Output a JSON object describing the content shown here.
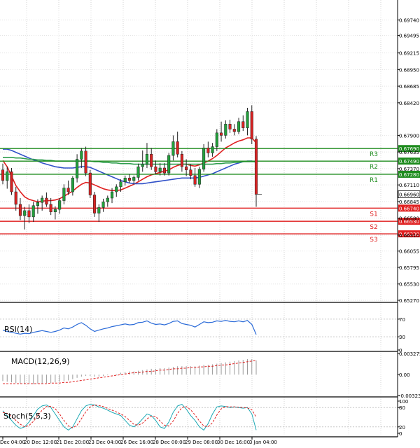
{
  "chart_data": [
    {
      "type": "candlestick",
      "panel": "price",
      "title": "",
      "ylim": [
        0.6527,
        0.6997
      ],
      "y_ticks": [
        "0.69740",
        "0.69495",
        "0.69215",
        "0.68950",
        "0.68685",
        "0.68420",
        "0.67900",
        "0.67635",
        "0.67370",
        "0.67110",
        "0.66845",
        "0.66580",
        "0.66310",
        "0.66055",
        "0.65795",
        "0.65530",
        "0.65270"
      ],
      "x_tick_labels": [
        "Dec 04:00",
        "20 Dec 12:00",
        "21 Dec 20:00",
        "23 Dec 04:00",
        "26 Dec 16:00",
        "28 Dec 00:00",
        "29 Dec 08:00",
        "30 Dec 16:00",
        "3 Jan 04:00"
      ],
      "last_price": "0.66960",
      "levels": [
        {
          "name": "R3",
          "value": 0.6769,
          "label": "0.67690",
          "color": "#1e8c1e"
        },
        {
          "name": "R2",
          "value": 0.6749,
          "label": "0.67490",
          "color": "#1e8c1e"
        },
        {
          "name": "R1",
          "value": 0.6728,
          "label": "0.67280",
          "color": "#1e8c1e"
        },
        {
          "name": "S1",
          "value": 0.6674,
          "label": "0.66740",
          "color": "#e02020"
        },
        {
          "name": "S2",
          "value": 0.6653,
          "label": "0.66530",
          "color": "#e02020"
        },
        {
          "name": "S3",
          "value": 0.6633,
          "label": "0.66330",
          "color": "#e02020"
        }
      ],
      "candles": [
        [
          0.6735,
          0.6745,
          0.6712,
          0.6718
        ],
        [
          0.6718,
          0.674,
          0.6705,
          0.6732
        ],
        [
          0.6732,
          0.6738,
          0.6695,
          0.67
        ],
        [
          0.67,
          0.6708,
          0.667,
          0.668
        ],
        [
          0.668,
          0.669,
          0.6655,
          0.6662
        ],
        [
          0.6662,
          0.6676,
          0.664,
          0.667
        ],
        [
          0.667,
          0.668,
          0.665,
          0.666
        ],
        [
          0.666,
          0.6684,
          0.6652,
          0.6678
        ],
        [
          0.6678,
          0.6688,
          0.6665,
          0.6683
        ],
        [
          0.6683,
          0.6694,
          0.667,
          0.669
        ],
        [
          0.669,
          0.6699,
          0.6676,
          0.668
        ],
        [
          0.668,
          0.669,
          0.6663,
          0.6668
        ],
        [
          0.6668,
          0.6677,
          0.6656,
          0.6672
        ],
        [
          0.6672,
          0.669,
          0.6665,
          0.6686
        ],
        [
          0.6686,
          0.6712,
          0.668,
          0.6706
        ],
        [
          0.6706,
          0.6718,
          0.6695,
          0.67
        ],
        [
          0.67,
          0.6725,
          0.6694,
          0.6722
        ],
        [
          0.6722,
          0.676,
          0.6715,
          0.6752
        ],
        [
          0.6752,
          0.677,
          0.6738,
          0.6765
        ],
        [
          0.6765,
          0.6772,
          0.6725,
          0.673
        ],
        [
          0.673,
          0.6735,
          0.669,
          0.6695
        ],
        [
          0.6695,
          0.67,
          0.666,
          0.6666
        ],
        [
          0.6666,
          0.668,
          0.6652,
          0.6675
        ],
        [
          0.6675,
          0.6689,
          0.6668,
          0.6684
        ],
        [
          0.6684,
          0.6694,
          0.6676,
          0.669
        ],
        [
          0.669,
          0.6706,
          0.6682,
          0.67
        ],
        [
          0.67,
          0.6712,
          0.6692,
          0.6708
        ],
        [
          0.6708,
          0.672,
          0.67,
          0.6716
        ],
        [
          0.6716,
          0.6726,
          0.671,
          0.6722
        ],
        [
          0.6722,
          0.6728,
          0.6714,
          0.6718
        ],
        [
          0.6718,
          0.6726,
          0.6712,
          0.6723
        ],
        [
          0.6723,
          0.6745,
          0.6718,
          0.674
        ],
        [
          0.674,
          0.6766,
          0.6732,
          0.6744
        ],
        [
          0.6744,
          0.6778,
          0.6738,
          0.676
        ],
        [
          0.676,
          0.677,
          0.6735,
          0.674
        ],
        [
          0.674,
          0.675,
          0.6728,
          0.6732
        ],
        [
          0.6732,
          0.6746,
          0.6726,
          0.6738
        ],
        [
          0.6738,
          0.6746,
          0.6726,
          0.673
        ],
        [
          0.673,
          0.6762,
          0.6726,
          0.6758
        ],
        [
          0.6758,
          0.679,
          0.675,
          0.678
        ],
        [
          0.678,
          0.6796,
          0.6755,
          0.676
        ],
        [
          0.676,
          0.6765,
          0.6732,
          0.674
        ],
        [
          0.674,
          0.6752,
          0.6725,
          0.6735
        ],
        [
          0.6735,
          0.6744,
          0.672,
          0.6726
        ],
        [
          0.6726,
          0.6738,
          0.6708,
          0.6712
        ],
        [
          0.6712,
          0.674,
          0.6706,
          0.6736
        ],
        [
          0.6736,
          0.6776,
          0.6732,
          0.677
        ],
        [
          0.677,
          0.678,
          0.6755,
          0.6762
        ],
        [
          0.6762,
          0.6778,
          0.6756,
          0.6772
        ],
        [
          0.6772,
          0.68,
          0.6765,
          0.6794
        ],
        [
          0.6794,
          0.6812,
          0.678,
          0.679
        ],
        [
          0.679,
          0.6814,
          0.6785,
          0.6808
        ],
        [
          0.6808,
          0.6815,
          0.6794,
          0.68
        ],
        [
          0.68,
          0.6808,
          0.679,
          0.6796
        ],
        [
          0.6796,
          0.6818,
          0.6792,
          0.6812
        ],
        [
          0.6812,
          0.6822,
          0.6797,
          0.6802
        ],
        [
          0.6802,
          0.6834,
          0.679,
          0.6828
        ],
        [
          0.6828,
          0.6838,
          0.6776,
          0.6784
        ],
        [
          0.6784,
          0.6789,
          0.6676,
          0.6696
        ]
      ],
      "series": [
        {
          "name": "",
          "color": "#e02020",
          "values": [
            0.675,
            0.674,
            0.6725,
            0.671,
            0.67,
            0.6692,
            0.6688,
            0.6686,
            0.6684,
            0.6685,
            0.6686,
            0.6686,
            0.6687,
            0.6689,
            0.6693,
            0.6697,
            0.6701,
            0.6707,
            0.6712,
            0.6715,
            0.6714,
            0.6711,
            0.6708,
            0.6705,
            0.6703,
            0.6702,
            0.6702,
            0.6703,
            0.6706,
            0.6709,
            0.6712,
            0.6716,
            0.672,
            0.6724,
            0.6727,
            0.6729,
            0.6731,
            0.6733,
            0.6735,
            0.6739,
            0.6742,
            0.6744,
            0.6744,
            0.6742,
            0.6741,
            0.6743,
            0.6746,
            0.6749,
            0.6753,
            0.6758,
            0.6764,
            0.677,
            0.6774,
            0.6778,
            0.6781,
            0.6783,
            0.6786,
            0.6786,
            0.6778
          ]
        },
        {
          "name": "",
          "color": "#3050c8",
          "values": [
            0.6768,
            0.6768,
            0.6766,
            0.6763,
            0.676,
            0.6757,
            0.6754,
            0.6751,
            0.6749,
            0.6746,
            0.6744,
            0.6742,
            0.674,
            0.6739,
            0.6738,
            0.6738,
            0.6738,
            0.6739,
            0.674,
            0.674,
            0.6739,
            0.6736,
            0.6733,
            0.673,
            0.6727,
            0.6724,
            0.6721,
            0.6718,
            0.6716,
            0.6714,
            0.6713,
            0.6713,
            0.6713,
            0.6714,
            0.6715,
            0.6716,
            0.6717,
            0.6718,
            0.6719,
            0.672,
            0.6721,
            0.6722,
            0.6722,
            0.6722,
            0.6722,
            0.6723,
            0.6725,
            0.6727,
            0.6729,
            0.6732,
            0.6735,
            0.6738,
            0.6741,
            0.6744,
            0.6746,
            0.6748,
            0.6749,
            0.6749,
            0.6747
          ]
        },
        {
          "name": "",
          "color": "#2e9e4e",
          "values": [
            0.6755,
            0.6755,
            0.6755,
            0.6754,
            0.6754,
            0.6753,
            0.6752,
            0.6752,
            0.6751,
            0.6751,
            0.675,
            0.675,
            0.6749,
            0.6749,
            0.6749,
            0.6749,
            0.6749,
            0.6749,
            0.6749,
            0.6749,
            0.6749,
            0.6748,
            0.6748,
            0.6747,
            0.6747,
            0.6746,
            0.6746,
            0.6745,
            0.6745,
            0.6745,
            0.6744,
            0.6744,
            0.6744,
            0.6744,
            0.6744,
            0.6744,
            0.6744,
            0.6744,
            0.6744,
            0.6744,
            0.6744,
            0.6744,
            0.6744,
            0.6744,
            0.6744,
            0.6744,
            0.6744,
            0.6744,
            0.6744,
            0.6745,
            0.6745,
            0.6746,
            0.6746,
            0.6747,
            0.6747,
            0.6748,
            0.6748,
            0.6748,
            0.6748
          ]
        }
      ]
    },
    {
      "type": "line",
      "panel": "rsi",
      "title": "RSI(14)",
      "ylim": [
        0,
        100
      ],
      "y_ticks": [
        "70",
        "30",
        "0"
      ],
      "series": [
        {
          "name": "RSI(14)",
          "color": "#2a6ad8",
          "values": [
            45,
            42,
            40,
            38,
            36,
            38,
            37,
            40,
            42,
            44,
            42,
            40,
            42,
            45,
            50,
            48,
            52,
            58,
            62,
            56,
            48,
            42,
            45,
            48,
            50,
            53,
            55,
            57,
            59,
            57,
            58,
            62,
            63,
            66,
            61,
            58,
            59,
            57,
            60,
            65,
            66,
            60,
            58,
            56,
            52,
            58,
            64,
            62,
            63,
            66,
            65,
            67,
            65,
            64,
            66,
            64,
            67,
            58,
            35
          ]
        }
      ]
    },
    {
      "type": "bar",
      "panel": "macd",
      "title": "MACD(12,26,9)",
      "ylim": [
        -0.003234,
        0.003275
      ],
      "y_ticks": [
        "0.003275",
        "0.00",
        "-0.003234"
      ],
      "values": [
        -0.001,
        -0.0011,
        -0.0012,
        -0.0013,
        -0.0014,
        -0.0015,
        -0.0015,
        -0.0015,
        -0.0014,
        -0.0014,
        -0.0013,
        -0.0013,
        -0.0012,
        -0.0011,
        -0.001,
        -0.0009,
        -0.0007,
        -0.0005,
        -0.0003,
        -0.0002,
        -0.0002,
        -0.0003,
        -0.0003,
        -0.0002,
        -0.0001,
        0.0,
        0.0001,
        0.0003,
        0.0004,
        0.0005,
        0.0005,
        0.0006,
        0.0007,
        0.0008,
        0.0009,
        0.0009,
        0.001,
        0.001,
        0.0011,
        0.0012,
        0.0013,
        0.0013,
        0.0013,
        0.0013,
        0.0013,
        0.0014,
        0.0015,
        0.0015,
        0.0016,
        0.0017,
        0.0018,
        0.0019,
        0.002,
        0.0021,
        0.0022,
        0.0023,
        0.0024,
        0.0024,
        0.0022
      ],
      "signal": [
        -0.0014,
        -0.0014,
        -0.0014,
        -0.0014,
        -0.0014,
        -0.0014,
        -0.0014,
        -0.0014,
        -0.0014,
        -0.0014,
        -0.0014,
        -0.0013,
        -0.0013,
        -0.0013,
        -0.0012,
        -0.0012,
        -0.0011,
        -0.001,
        -0.0009,
        -0.0008,
        -0.0007,
        -0.0006,
        -0.0005,
        -0.0004,
        -0.0003,
        -0.0002,
        -0.0001,
        0.0,
        0.0001,
        0.0002,
        0.0003,
        0.0003,
        0.0004,
        0.0005,
        0.0005,
        0.0006,
        0.0007,
        0.0007,
        0.0008,
        0.0009,
        0.0009,
        0.001,
        0.001,
        0.0011,
        0.0011,
        0.0012,
        0.0012,
        0.0013,
        0.0013,
        0.0014,
        0.0015,
        0.0015,
        0.0016,
        0.0017,
        0.0018,
        0.0019,
        0.002,
        0.0021,
        0.0022
      ],
      "colors": {
        "histogram": "#9a9a9a",
        "signal": "#e02020"
      }
    },
    {
      "type": "line",
      "panel": "stoch",
      "title": "Stoch(5,5,3)",
      "ylim": [
        0,
        100
      ],
      "y_ticks": [
        "100",
        "80",
        "20",
        "0"
      ],
      "series": [
        {
          "name": "",
          "color": "#1aa8b4",
          "values": [
            70,
            55,
            40,
            25,
            15,
            20,
            35,
            55,
            75,
            85,
            88,
            80,
            60,
            40,
            20,
            10,
            20,
            45,
            70,
            85,
            90,
            88,
            82,
            78,
            72,
            65,
            60,
            55,
            40,
            25,
            20,
            30,
            45,
            60,
            55,
            40,
            20,
            15,
            35,
            65,
            85,
            90,
            75,
            55,
            40,
            20,
            10,
            30,
            60,
            82,
            85,
            83,
            80,
            82,
            80,
            78,
            80,
            60,
            10
          ]
        },
        {
          "name": "",
          "color": "#e02020",
          "values": [
            65,
            62,
            52,
            40,
            28,
            20,
            24,
            37,
            55,
            72,
            83,
            84,
            76,
            60,
            40,
            23,
            17,
            25,
            45,
            67,
            82,
            88,
            86,
            83,
            77,
            72,
            66,
            60,
            52,
            40,
            28,
            25,
            32,
            45,
            53,
            52,
            38,
            25,
            23,
            38,
            62,
            80,
            83,
            73,
            57,
            38,
            23,
            20,
            33,
            57,
            76,
            83,
            82,
            82,
            81,
            80,
            79,
            73,
            50
          ]
        }
      ]
    }
  ]
}
